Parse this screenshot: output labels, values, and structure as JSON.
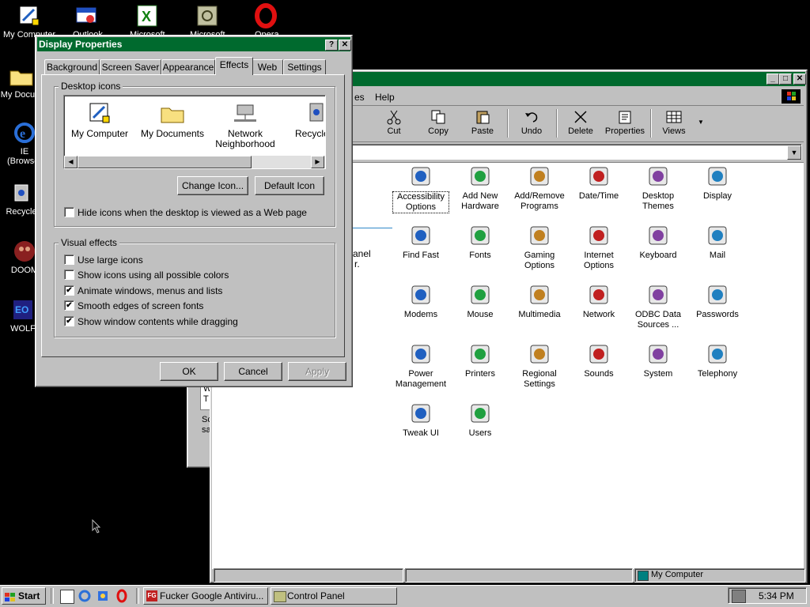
{
  "desktop": {
    "icons": [
      {
        "label": "My Computer",
        "icon": "my-computer-icon"
      },
      {
        "label": "My Docum",
        "icon": "folder-icon"
      },
      {
        "label": "IE",
        "label2": "(Browser",
        "icon": "ie-icon"
      },
      {
        "label": "Recycle",
        "icon": "recycle-bin-icon"
      },
      {
        "label": "DOOM",
        "icon": "doom-icon"
      },
      {
        "label": "WOLF",
        "icon": "wolf-icon"
      }
    ],
    "top_icons": [
      "Outlook",
      "Microsoft",
      "Microsoft",
      "Opera"
    ]
  },
  "control_panel": {
    "title": "",
    "menu": {
      "help": "Help",
      "partial": "es"
    },
    "toolbar": [
      {
        "label": "Cut",
        "icon": "scissors-icon"
      },
      {
        "label": "Copy",
        "icon": "copy-icon"
      },
      {
        "label": "Paste",
        "icon": "paste-icon"
      },
      {
        "label": "Undo",
        "icon": "undo-icon"
      },
      {
        "label": "Delete",
        "icon": "delete-icon"
      },
      {
        "label": "Properties",
        "icon": "properties-icon"
      },
      {
        "label": "Views",
        "icon": "views-icon"
      }
    ],
    "side_text": [
      "anel",
      "r."
    ],
    "items": [
      {
        "label": "Accessibility Options",
        "icon": "accessibility-icon"
      },
      {
        "label": "Add New Hardware",
        "icon": "hardware-icon"
      },
      {
        "label": "Add/Remove Programs",
        "icon": "programs-icon"
      },
      {
        "label": "Date/Time",
        "icon": "clock-icon"
      },
      {
        "label": "Desktop Themes",
        "icon": "themes-icon"
      },
      {
        "label": "Display",
        "icon": "display-icon"
      },
      {
        "label": "Find Fast",
        "icon": "binoculars-icon"
      },
      {
        "label": "Fonts",
        "icon": "fonts-folder-icon"
      },
      {
        "label": "Gaming Options",
        "icon": "joystick-icon"
      },
      {
        "label": "Internet Options",
        "icon": "globe-icon"
      },
      {
        "label": "Keyboard",
        "icon": "keyboard-icon"
      },
      {
        "label": "Mail",
        "icon": "mail-icon"
      },
      {
        "label": "Modems",
        "icon": "modem-icon"
      },
      {
        "label": "Mouse",
        "icon": "mouse-icon"
      },
      {
        "label": "Multimedia",
        "icon": "multimedia-icon"
      },
      {
        "label": "Network",
        "icon": "network-icon"
      },
      {
        "label": "ODBC Data Sources ...",
        "icon": "odbc-icon"
      },
      {
        "label": "Passwords",
        "icon": "keys-icon"
      },
      {
        "label": "Power Management",
        "icon": "power-icon"
      },
      {
        "label": "Printers",
        "icon": "printer-folder-icon"
      },
      {
        "label": "Regional Settings",
        "icon": "world-icon"
      },
      {
        "label": "Sounds",
        "icon": "speaker-icon"
      },
      {
        "label": "System",
        "icon": "computer-icon"
      },
      {
        "label": "Telephony",
        "icon": "telephone-icon"
      },
      {
        "label": "Tweak UI",
        "icon": "tweakui-icon"
      },
      {
        "label": "Users",
        "icon": "users-icon"
      }
    ],
    "status": {
      "location": "My Computer"
    }
  },
  "behind_window": {
    "text1": "W",
    "text2": "T",
    "text3": "Sc",
    "text4": "sa"
  },
  "dialog": {
    "title": "Display Properties",
    "tabs": [
      "Background",
      "Screen Saver",
      "Appearance",
      "Effects",
      "Web",
      "Settings"
    ],
    "active_tab": "Effects",
    "desktop_icons_group": "Desktop icons",
    "desktop_icons": [
      {
        "label": "My Computer",
        "icon": "my-computer-icon"
      },
      {
        "label": "My Documents",
        "icon": "folder-icon"
      },
      {
        "label": "Network Neighborhood",
        "icon": "network-neighborhood-icon"
      },
      {
        "label": "Recycle B",
        "icon": "recycle-bin-icon"
      }
    ],
    "change_icon": "Change Icon...",
    "default_icon": "Default Icon",
    "hide_icons": {
      "label": "Hide icons when the desktop is viewed as a Web page",
      "checked": false
    },
    "visual_effects_group": "Visual effects",
    "effects": [
      {
        "label": "Use large icons",
        "checked": false
      },
      {
        "label": "Show icons using all possible colors",
        "checked": false
      },
      {
        "label": "Animate windows, menus and lists",
        "checked": true
      },
      {
        "label": "Smooth edges of screen fonts",
        "checked": true
      },
      {
        "label": "Show window contents while dragging",
        "checked": true
      }
    ],
    "ok": "OK",
    "cancel": "Cancel",
    "apply": "Apply"
  },
  "taskbar": {
    "start": "Start",
    "tasks": [
      "Fucker Google Antiviru...",
      "Control Panel"
    ],
    "clock": "5:34 PM"
  },
  "colors": {
    "desktop": "#000000",
    "title_active": "#006a2e",
    "title_inactive_cp": "#006a2e",
    "face": "#c0c0c0"
  }
}
